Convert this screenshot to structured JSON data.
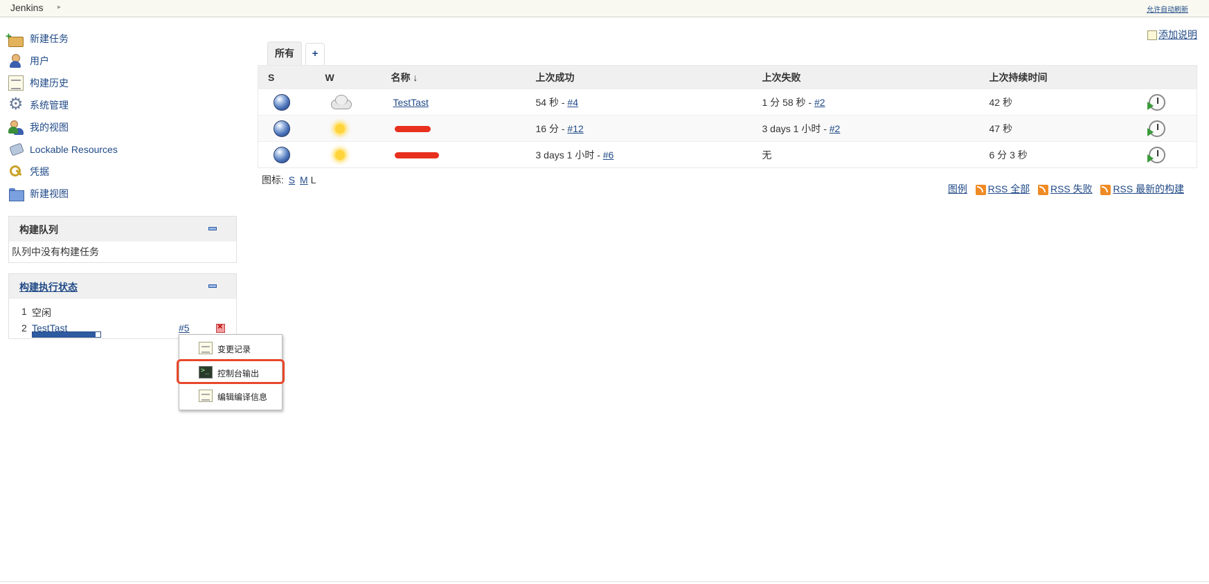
{
  "breadcrumb": {
    "root": "Jenkins",
    "auto_refresh": "允许自动刷新"
  },
  "tasks": [
    {
      "label": "新建任务",
      "icon": "new-item-icon"
    },
    {
      "label": "用户",
      "icon": "user-icon"
    },
    {
      "label": "构建历史",
      "icon": "notepad-icon"
    },
    {
      "label": "系统管理",
      "icon": "gear-icon"
    },
    {
      "label": "我的视图",
      "icon": "users-icon"
    },
    {
      "label": "Lockable Resources",
      "icon": "lock-icon"
    },
    {
      "label": "凭据",
      "icon": "key-icon"
    },
    {
      "label": "新建视图",
      "icon": "folder-icon"
    }
  ],
  "queue": {
    "title": "构建队列",
    "empty_text": "队列中没有构建任务"
  },
  "executors": {
    "title": "构建执行状态",
    "rows": [
      {
        "num": "1",
        "status": "空闲"
      },
      {
        "num": "2",
        "job": "TestTast",
        "build": "#5",
        "progress": 0.93
      }
    ]
  },
  "context_menu": {
    "items": [
      {
        "label": "变更记录",
        "icon": "changes-icon"
      },
      {
        "label": "控制台输出",
        "icon": "terminal-icon",
        "highlighted": true
      },
      {
        "label": "编辑编译信息",
        "icon": "edit-icon"
      }
    ]
  },
  "view_tabs": {
    "active": "所有",
    "add": "+"
  },
  "description": {
    "add_label": "添加说明"
  },
  "table": {
    "headers": {
      "s": "S",
      "w": "W",
      "name": "名称",
      "sort_arrow": "↓",
      "last_success": "上次成功",
      "last_failure": "上次失败",
      "last_duration": "上次持续时间"
    },
    "rows": [
      {
        "status": "blue",
        "weather": "cloudy",
        "name": "TestTast",
        "redacted": false,
        "last_success": "54 秒 - ",
        "last_success_build": "#4",
        "last_failure": "1 分 58 秒 - ",
        "last_failure_build": "#2",
        "last_duration": "42 秒"
      },
      {
        "status": "blue",
        "weather": "sunny",
        "name": "",
        "redacted": true,
        "last_success": "16 分 - ",
        "last_success_build": "#12",
        "last_failure": "3 days 1 小时 - ",
        "last_failure_build": "#2",
        "last_duration": "47 秒"
      },
      {
        "status": "blue",
        "weather": "sunny",
        "name": "",
        "redacted": true,
        "last_success": "3 days 1 小时 - ",
        "last_success_build": "#6",
        "last_failure": "无",
        "last_failure_build": "",
        "last_duration": "6 分 3 秒"
      }
    ]
  },
  "icon_size": {
    "label": "图标:",
    "s": "S",
    "m": "M",
    "l": "L"
  },
  "legend_links": {
    "legend": "图例",
    "rss_all": "RSS 全部",
    "rss_failed": "RSS 失败",
    "rss_latest": "RSS 最新的构建"
  }
}
